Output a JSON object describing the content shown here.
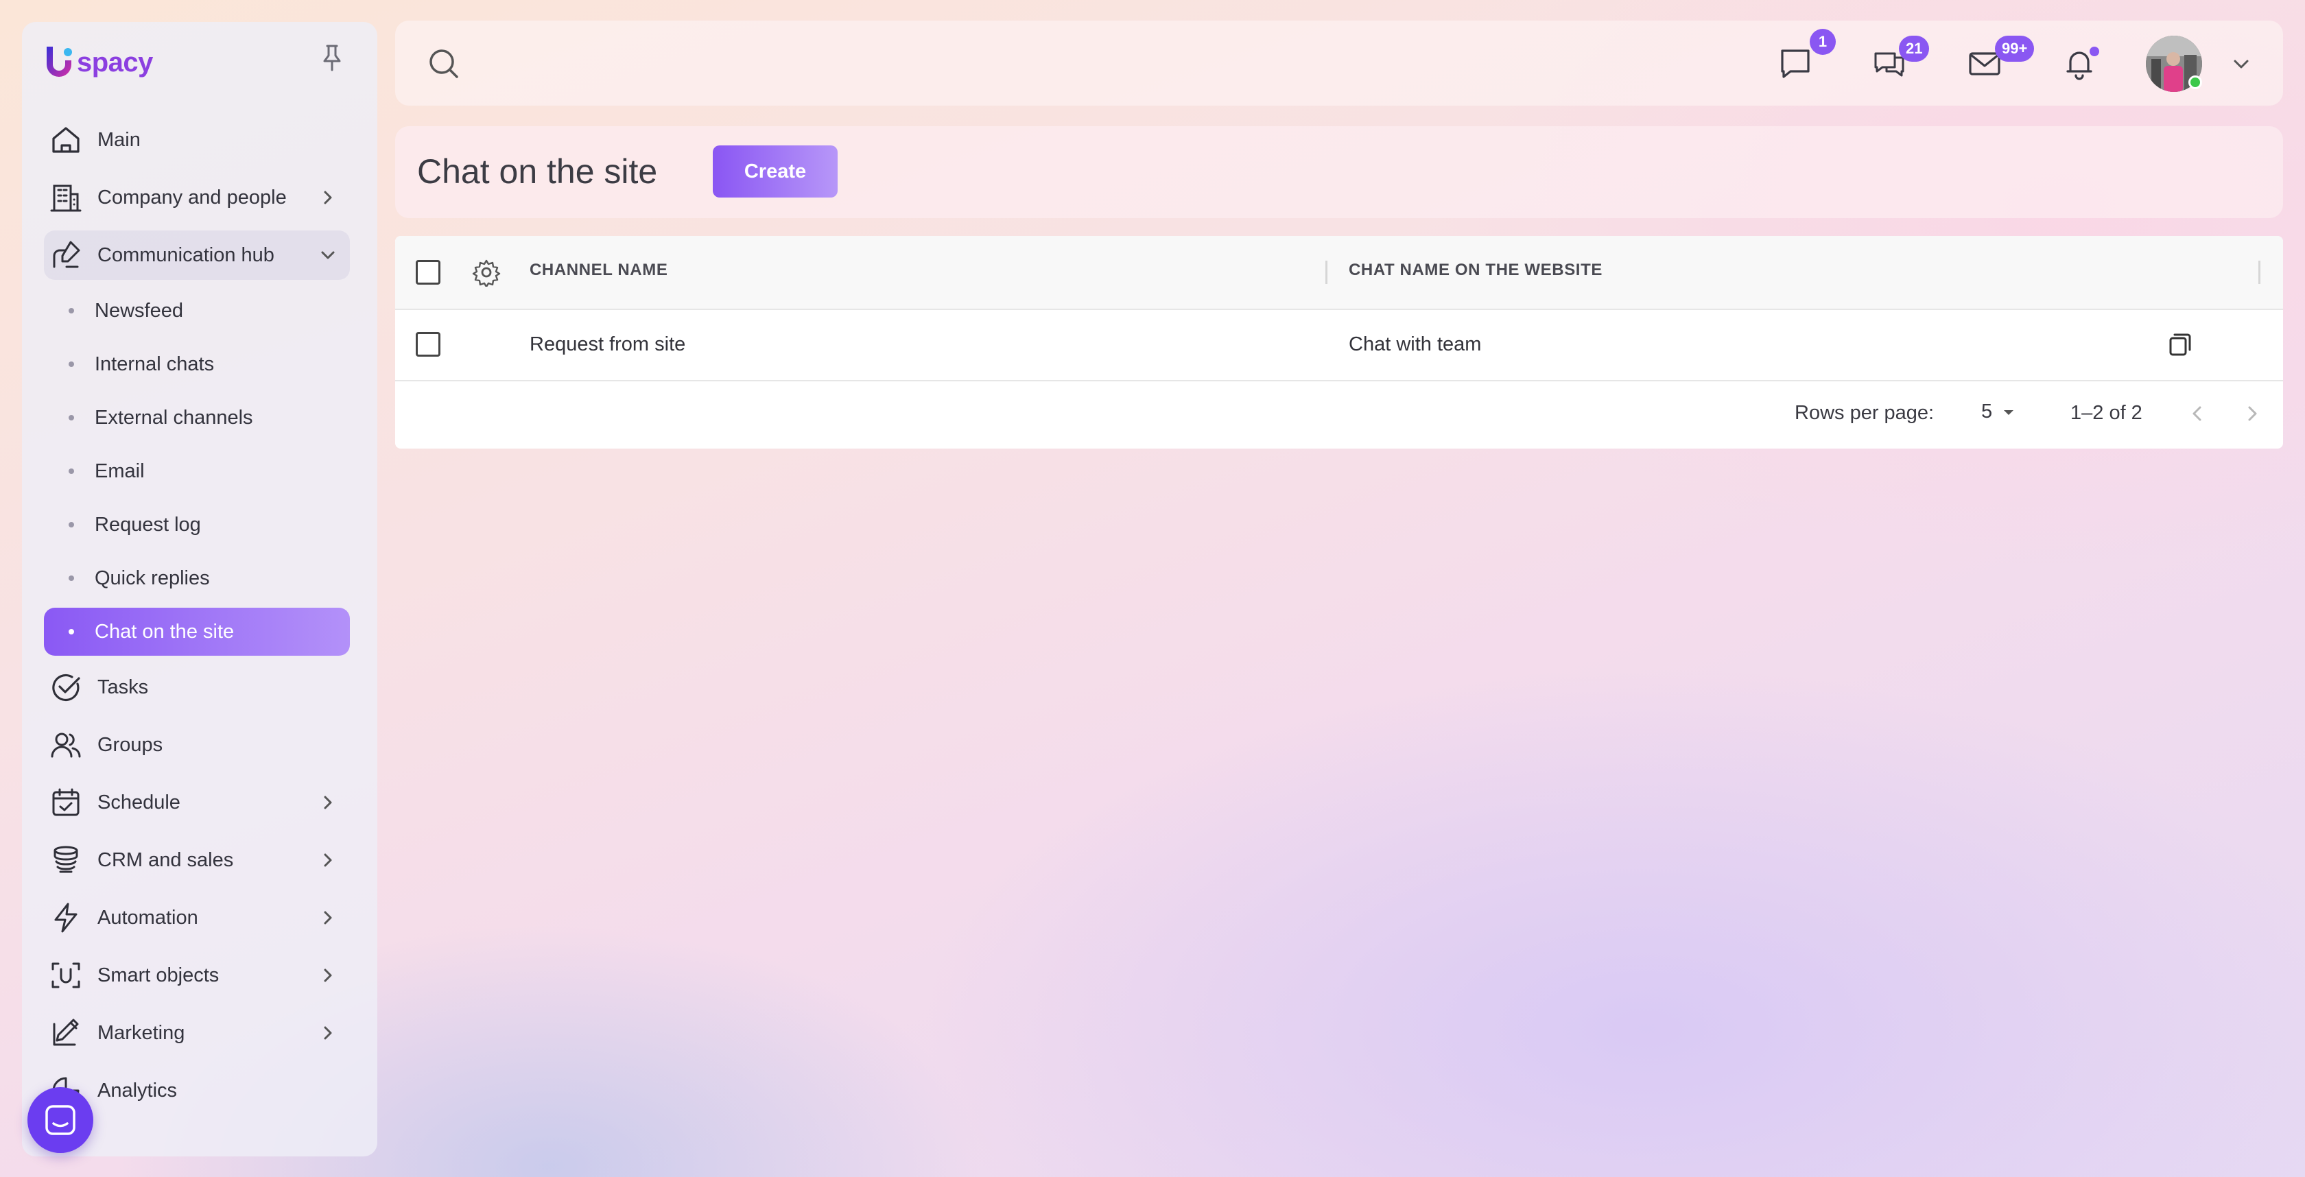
{
  "brand": {
    "name": "spacy",
    "accent": "#8a57f2"
  },
  "sidebar": {
    "items": [
      {
        "label": "Main",
        "icon": "home-icon"
      },
      {
        "label": "Company and people",
        "icon": "building-icon",
        "expandable": true
      },
      {
        "label": "Communication hub",
        "icon": "chat-route-icon",
        "expanded": true,
        "children": [
          {
            "label": "Newsfeed"
          },
          {
            "label": "Internal chats"
          },
          {
            "label": "External channels"
          },
          {
            "label": "Email"
          },
          {
            "label": "Request log"
          },
          {
            "label": "Quick replies"
          },
          {
            "label": "Chat on the site",
            "active": true
          }
        ]
      },
      {
        "label": "Tasks",
        "icon": "check-circle-icon"
      },
      {
        "label": "Groups",
        "icon": "users-icon"
      },
      {
        "label": "Schedule",
        "icon": "calendar-check-icon",
        "expandable": true
      },
      {
        "label": "CRM and sales",
        "icon": "coins-icon",
        "expandable": true
      },
      {
        "label": "Automation",
        "icon": "lightning-icon",
        "expandable": true
      },
      {
        "label": "Smart objects",
        "icon": "scan-icon",
        "expandable": true
      },
      {
        "label": "Marketing",
        "icon": "megaphone-icon",
        "expandable": true
      },
      {
        "label": "Analytics",
        "icon": "chart-icon"
      }
    ]
  },
  "topbar": {
    "notifications": {
      "chats_badge": "1",
      "messages_badge": "21",
      "mail_badge": "99+",
      "bell_has_dot": true
    },
    "user_online": true
  },
  "page": {
    "title": "Chat on the site",
    "create_label": "Create"
  },
  "table": {
    "columns": [
      "CHANNEL NAME",
      "CHAT NAME ON THE WEBSITE"
    ],
    "rows": [
      {
        "channel_name": "Request from site",
        "chat_name": "Chat with team"
      }
    ],
    "footer": {
      "rows_per_page_label": "Rows per page:",
      "rows_per_page_value": "5",
      "range": "1–2 of 2"
    }
  }
}
